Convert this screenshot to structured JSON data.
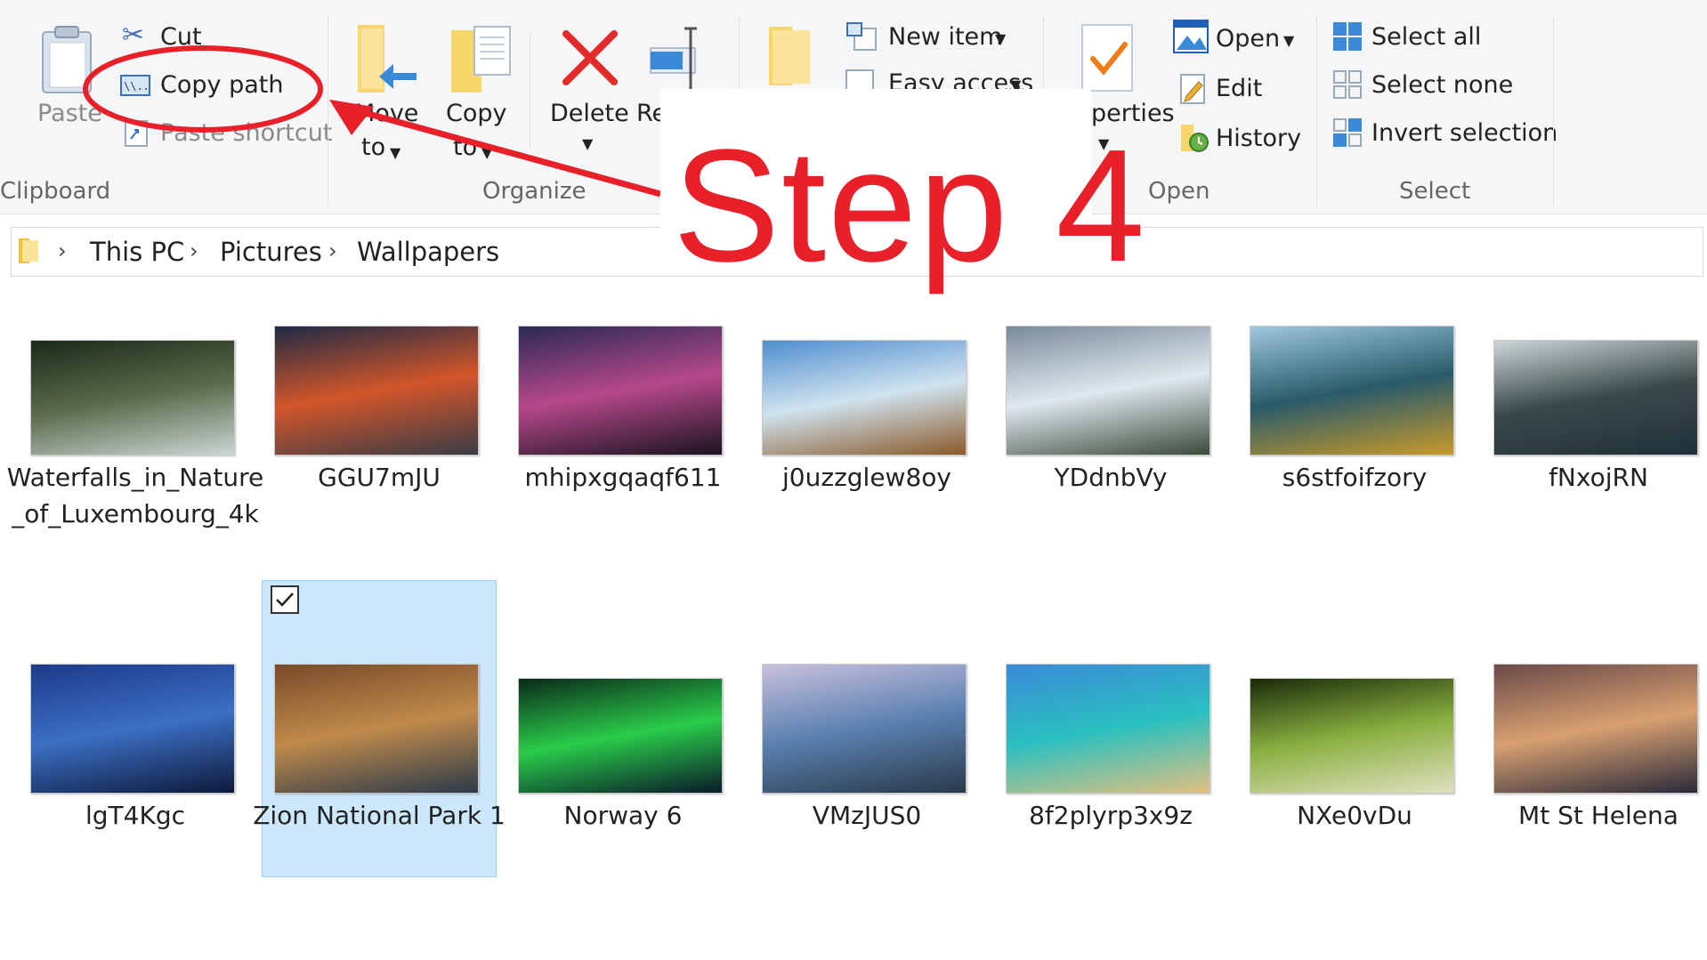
{
  "ribbon": {
    "clipboard": {
      "paste": "Paste",
      "cut": "Cut",
      "copy_path": "Copy path",
      "paste_shortcut": "Paste shortcut",
      "label": "Clipboard"
    },
    "organize": {
      "move_to": [
        "Move",
        "to"
      ],
      "copy_to": [
        "Copy",
        "to"
      ],
      "delete": "Delete",
      "rename": "Re",
      "label": "Organize"
    },
    "new": {
      "new_item": "New item",
      "easy_access": "Easy access"
    },
    "open": {
      "properties": "perties",
      "open": "Open",
      "edit": "Edit",
      "history": "History",
      "label": "Open"
    },
    "select": {
      "select_all": "Select all",
      "select_none": "Select none",
      "invert": "Invert selection",
      "label": "Select"
    }
  },
  "breadcrumb": [
    "This PC",
    "Pictures",
    "Wallpapers"
  ],
  "annotation": {
    "step": "Step 4",
    "color": "#e8202a"
  },
  "files": [
    {
      "name": "Waterfalls_in_Nature_of_Luxembourg_4k",
      "icon": "image-thumbnail",
      "colors": [
        "#1a2a1a",
        "#5a6a4a",
        "#c9d6d4"
      ]
    },
    {
      "name": "GGU7mJU",
      "icon": "image-thumbnail",
      "colors": [
        "#1f2a44",
        "#d2562a",
        "#3a3c45"
      ]
    },
    {
      "name": "mhipxgqaqf611",
      "icon": "image-thumbnail",
      "colors": [
        "#2a2a55",
        "#b6488a",
        "#1a1420"
      ]
    },
    {
      "name": "j0uzzglew8oy",
      "icon": "image-thumbnail",
      "colors": [
        "#4f8ed0",
        "#cfe3ef",
        "#8a5a2a"
      ]
    },
    {
      "name": "YDdnbVy",
      "icon": "image-thumbnail",
      "colors": [
        "#7a8a9a",
        "#dfe8ef",
        "#3a4a3a"
      ]
    },
    {
      "name": "s6stfoifzory",
      "icon": "image-thumbnail",
      "colors": [
        "#9ec8de",
        "#2a5a6a",
        "#c89a2a"
      ]
    },
    {
      "name": "fNxojRN",
      "icon": "image-thumbnail",
      "colors": [
        "#cfd6d8",
        "#3a4a4a",
        "#20303a"
      ]
    },
    {
      "name": "lgT4Kgc",
      "icon": "image-thumbnail",
      "colors": [
        "#1e3a8a",
        "#3b6fc4",
        "#0e1a3a"
      ]
    },
    {
      "name": "Zion National Park 1",
      "icon": "image-thumbnail",
      "selected": true,
      "colors": [
        "#7a4a2a",
        "#c08a4a",
        "#2a3a4a"
      ]
    },
    {
      "name": "Norway 6",
      "icon": "image-thumbnail",
      "colors": [
        "#0a2a1a",
        "#2acc4a",
        "#0a1a2a"
      ]
    },
    {
      "name": "VMzJUS0",
      "icon": "image-thumbnail",
      "colors": [
        "#c8c0dc",
        "#5a80b0",
        "#2a3a4a"
      ]
    },
    {
      "name": "8f2plyrp3x9z",
      "icon": "image-thumbnail",
      "colors": [
        "#3a8ad8",
        "#2ac0c0",
        "#e0c080"
      ]
    },
    {
      "name": "NXe0vDu",
      "icon": "image-thumbnail",
      "colors": [
        "#1a2a0a",
        "#8ab040",
        "#e0e0c0"
      ]
    },
    {
      "name": "Mt St Helena",
      "icon": "image-thumbnail",
      "colors": [
        "#6a4a4a",
        "#d8a070",
        "#2a2a3a"
      ]
    }
  ]
}
